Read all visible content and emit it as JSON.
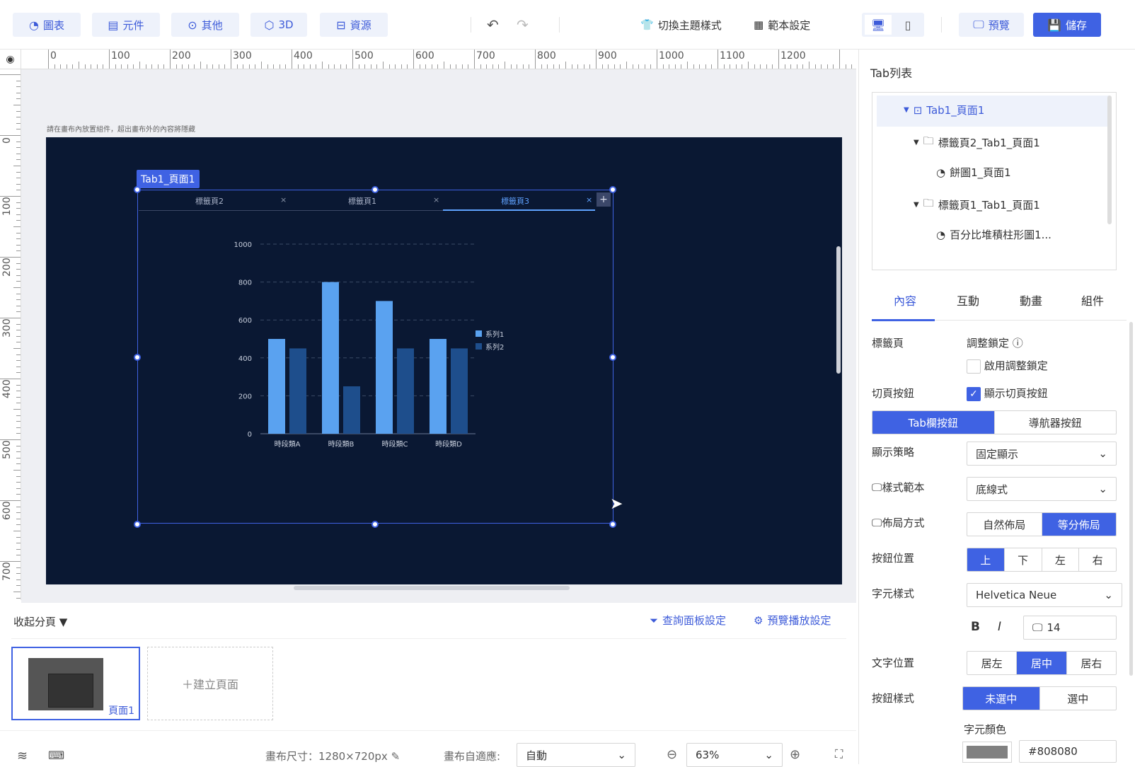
{
  "toolbar": {
    "chart_label": "圖表",
    "component_label": "元件",
    "other_label": "其他",
    "threed_label": "3D",
    "resource_label": "資源",
    "theme_label": "切換主題樣式",
    "template_label": "範本設定",
    "preview_label": "預覽",
    "save_label": "儲存"
  },
  "ruler": {
    "top": [
      "0",
      "100",
      "200",
      "300",
      "400",
      "500",
      "600",
      "700",
      "800",
      "900",
      "1000",
      "1100",
      "1200"
    ],
    "left": [
      "0",
      "100",
      "200",
      "300",
      "400",
      "500",
      "600",
      "700"
    ]
  },
  "canvas": {
    "hint": "請在畫布內放置組件，超出畫布外的內容將隱藏",
    "tab_container_label": "Tab1_頁面1",
    "tabs": [
      {
        "label": "標籤頁2"
      },
      {
        "label": "標籤頁1"
      },
      {
        "label": "標籤頁3"
      }
    ],
    "add_tab": "+",
    "close": "×"
  },
  "chart_data": {
    "type": "bar",
    "categories": [
      "時段類A",
      "時段類B",
      "時段類C",
      "時段類D"
    ],
    "series": [
      {
        "name": "系列1",
        "values": [
          500,
          800,
          700,
          500
        ]
      },
      {
        "name": "系列2",
        "values": [
          450,
          250,
          450,
          450
        ]
      }
    ],
    "ylim": [
      0,
      1000
    ],
    "yticks": [
      0,
      200,
      400,
      600,
      800,
      1000
    ],
    "grid": true,
    "legend": "right",
    "colors": [
      "#5aa2f0",
      "#1e4e8c"
    ]
  },
  "pages": {
    "collapse_label": "收起分頁",
    "query_panel_label": "查詢面板設定",
    "preview_play_label": "預覽播放設定",
    "page1_label": "頁面1",
    "new_page_label": "＋建立頁面"
  },
  "status": {
    "canvas_size": "畫布尺寸：1280×720px",
    "auto_fit_label": "畫布自適應:",
    "auto_fit_value": "自動",
    "zoom": "63%"
  },
  "panel": {
    "tab_list_title": "Tab列表",
    "tree": [
      {
        "label": "Tab1_頁面1"
      },
      {
        "label": "標籤頁2_Tab1_頁面1"
      },
      {
        "label": "餅圖1_頁面1"
      },
      {
        "label": "標籤頁1_Tab1_頁面1"
      },
      {
        "label": "百分比堆積柱形圖1..."
      }
    ],
    "tabs": [
      "內容",
      "互動",
      "動畫",
      "組件"
    ],
    "tab_page_label": "標籤頁",
    "lock_label": "調整鎖定",
    "enable_lock": "啟用調整鎖定",
    "page_button_label": "切頁按鈕",
    "show_page_button": "顯示切頁按鈕",
    "tabbar_button": "Tab欄按鈕",
    "nav_button": "導航器按鈕",
    "display_strategy_label": "顯示策略",
    "display_strategy_value": "固定顯示",
    "style_template_label": "樣式範本",
    "style_template_value": "底線式",
    "layout_label": "佈局方式",
    "layout_natural": "自然佈局",
    "layout_equal": "等分佈局",
    "btn_position_label": "按鈕位置",
    "positions": [
      "上",
      "下",
      "左",
      "右"
    ],
    "font_style_label": "字元樣式",
    "font_value": "Helvetica Neue",
    "bold": "B",
    "italic": "I",
    "font_size": "14",
    "text_position_label": "文字位置",
    "text_positions": [
      "居左",
      "居中",
      "居右"
    ],
    "btn_style_label": "按鈕樣式",
    "btn_styles": [
      "未選中",
      "選中"
    ],
    "font_color_label": "字元顏色",
    "font_color_value": "#808080"
  }
}
